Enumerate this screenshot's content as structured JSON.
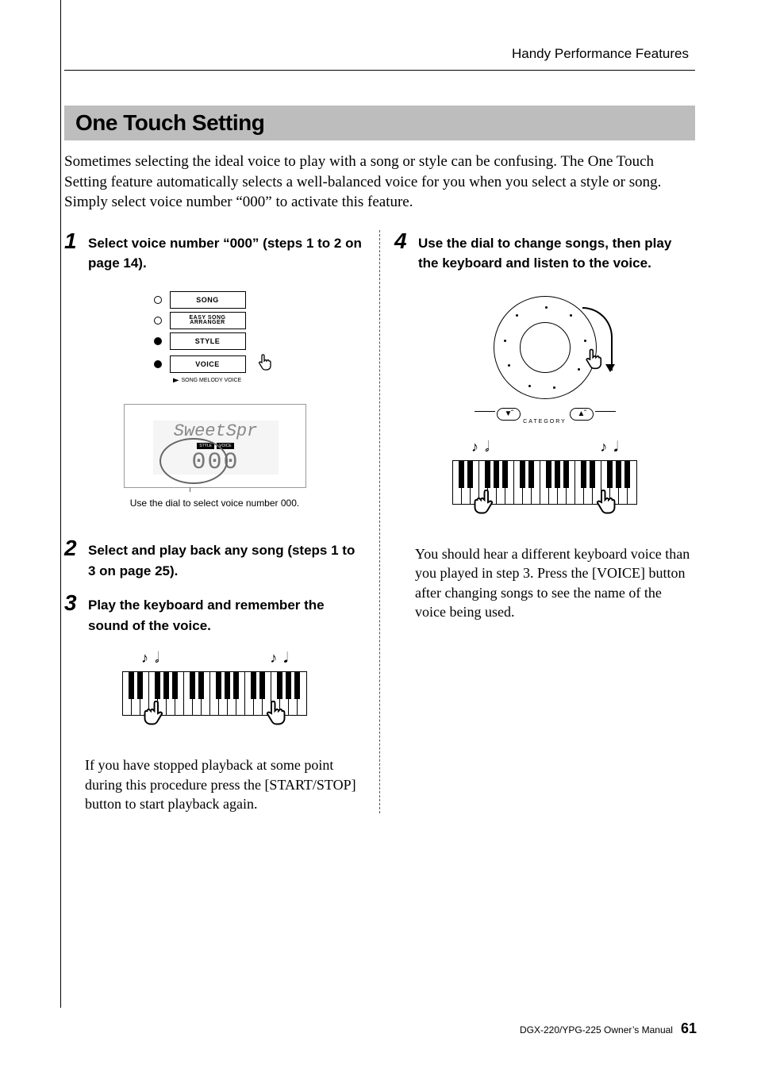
{
  "header": {
    "title": "Handy Performance Features"
  },
  "section": {
    "title": "One Touch Setting"
  },
  "intro": "Sometimes selecting the ideal voice to play with a song or style can be confusing. The One Touch Setting feature automatically selects a well-balanced voice for you when you select a style or song. Simply select voice number “000” to activate this feature.",
  "steps": {
    "s1": {
      "num": "1",
      "text": "Select voice number “000” (steps 1 to 2 on page 14)."
    },
    "s2": {
      "num": "2",
      "text": "Select and play back any song (steps 1 to 3 on page 25)."
    },
    "s3": {
      "num": "3",
      "text": "Play the keyboard and remember the sound of the voice."
    },
    "s4": {
      "num": "4",
      "text": "Use the dial to change songs, then play the keyboard and listen to the voice."
    }
  },
  "panel": {
    "buttons": [
      "SONG",
      "EASY SONG\nARRANGER",
      "STYLE",
      "VOICE"
    ],
    "sub_label": "SONG MELODY VOICE"
  },
  "lcd": {
    "voice_name": "SweetSpr",
    "number": "000",
    "chips": [
      "STYLE",
      "VOICE"
    ]
  },
  "caption": "Use the dial to select voice number 000.",
  "para_col1": "If you have stopped playback at some point during this procedure press the [START/STOP] button to start playback again.",
  "para_col2": "You should should hear a different keyboard voice than you played in step 3.  Press the [VOICE] button after changing songs to see the name of the voice being used.",
  "para_col2_fixed": "You should hear a different keyboard voice than you played in step 3.  Press the [VOICE] button after changing songs to see the name of the voice being used.",
  "dial": {
    "category_label": "CATEGORY",
    "left": "«",
    "right": "»"
  },
  "footer": {
    "manual": "DGX-220/YPG-225  Owner’s Manual",
    "page": "61"
  }
}
